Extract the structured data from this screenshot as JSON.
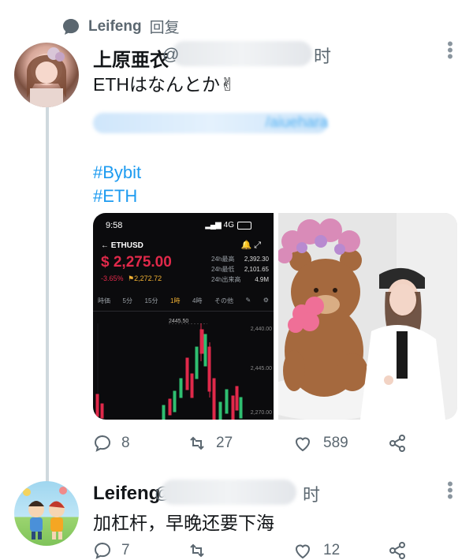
{
  "reply_header": {
    "user": "Leifeng",
    "action": "回复"
  },
  "tweet": {
    "author": "上原亜衣",
    "handle_prefix": "@",
    "time_suffix": "时",
    "text": "ETHはなんとか✌",
    "link_tail": "/aiuehara",
    "hashtags": [
      "#Bybit",
      "#ETH"
    ],
    "media": {
      "phone_time": "9:58",
      "network": "4G",
      "pair": "ETHUSD",
      "price": "$ 2,275.00",
      "change": "-3.65%",
      "flag_price": "2,272.72",
      "stats_labels": [
        "24h最高",
        "24h最低",
        "24h出来高"
      ],
      "stats_values": [
        "2,392.30",
        "2,101.65",
        "4.9M"
      ],
      "tabs": [
        "時価",
        "5分",
        "15分",
        "1時",
        "4時",
        "その他"
      ],
      "chart_marker": "2445.50",
      "axis_labels": [
        "2,440.00",
        "2,445.00",
        "2,270.00"
      ]
    },
    "actions": {
      "replies": "8",
      "retweets": "27",
      "likes": "589"
    }
  },
  "reply": {
    "author": "Leifeng",
    "handle_prefix": "@",
    "time_suffix": "时",
    "text": "加杠杆，早晚还要下海",
    "actions": {
      "replies": "7",
      "retweets": "",
      "likes": "12"
    }
  },
  "colors": {
    "link": "#1d9bf0",
    "muted": "#5b6770",
    "up": "#2fbf71",
    "down": "#e0294a"
  }
}
